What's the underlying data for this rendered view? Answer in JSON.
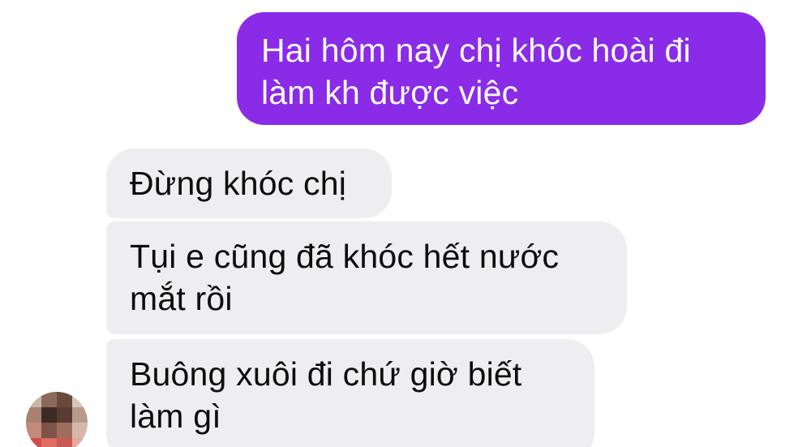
{
  "conversation": {
    "messages": [
      {
        "sender": "self",
        "text": "Hai hôm nay chị khóc hoài đi\nlàm kh được việc"
      },
      {
        "sender": "other",
        "text": "Đừng khóc chị"
      },
      {
        "sender": "other",
        "text": "Tụi e cũng đã khóc hết nước\nmắt rồi"
      },
      {
        "sender": "other",
        "text": "Buông xuôi đi chứ giờ biết\nlàm gì"
      }
    ]
  },
  "colors": {
    "outgoing_bubble": "#8a2be8",
    "incoming_bubble": "#eeeef0",
    "background": "#ffffff"
  },
  "avatar": {
    "style": "pixelated-blurred"
  }
}
